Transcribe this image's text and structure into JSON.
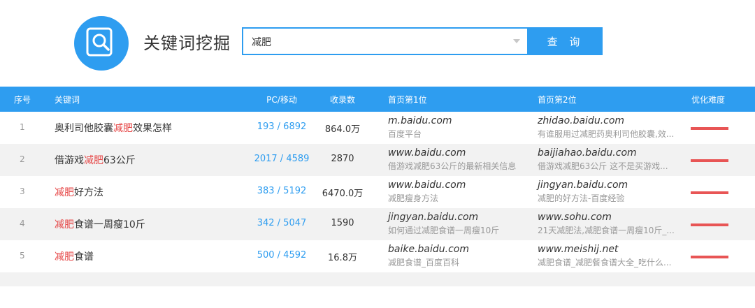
{
  "header": {
    "title": "关键词挖掘",
    "search_value": "减肥",
    "search_button": "查 询"
  },
  "table": {
    "headers": {
      "idx": "序号",
      "keyword": "关键词",
      "pc_mobile": "PC/移动",
      "indexed": "收录数",
      "page1_pos1": "首页第1位",
      "page1_pos2": "首页第2位",
      "difficulty": "优化难度"
    },
    "rows": [
      {
        "idx": "1",
        "kw_pre": "奥利司他胶囊",
        "kw_hl": "减肥",
        "kw_post": "效果怎样",
        "pc_mobile": "193 / 6892",
        "indexed": "864.0万",
        "p1_site": "m.baidu.com",
        "p1_desc": "百度平台",
        "p2_site": "zhidao.baidu.com",
        "p2_desc": "有谁服用过减肥药奥利司他胶囊,效...",
        "difficulty": "high"
      },
      {
        "idx": "2",
        "kw_pre": "借游戏",
        "kw_hl": "减肥",
        "kw_post": "63公斤",
        "pc_mobile": "2017 / 4589",
        "indexed": "2870",
        "p1_site": "www.baidu.com",
        "p1_desc": "借游戏减肥63公斤的最新相关信息",
        "p2_site": "baijiahao.baidu.com",
        "p2_desc": "借游戏减肥63公斤 这不是买游戏...",
        "difficulty": "high"
      },
      {
        "idx": "3",
        "kw_pre": "",
        "kw_hl": "减肥",
        "kw_post": "好方法",
        "pc_mobile": "383 / 5192",
        "indexed": "6470.0万",
        "p1_site": "www.baidu.com",
        "p1_desc": "减肥瘦身方法",
        "p2_site": "jingyan.baidu.com",
        "p2_desc": "减肥的好方法-百度经验",
        "difficulty": "high"
      },
      {
        "idx": "4",
        "kw_pre": "",
        "kw_hl": "减肥",
        "kw_post": "食谱一周瘦10斤",
        "pc_mobile": "342 / 5047",
        "indexed": "1590",
        "p1_site": "jingyan.baidu.com",
        "p1_desc": "如何通过减肥食谱一周瘦10斤",
        "p2_site": "www.sohu.com",
        "p2_desc": "21天减肥法,减肥食谱一周瘦10斤_...",
        "difficulty": "high"
      },
      {
        "idx": "5",
        "kw_pre": "",
        "kw_hl": "减肥",
        "kw_post": "食谱",
        "pc_mobile": "500 / 4592",
        "indexed": "16.8万",
        "p1_site": "baike.baidu.com",
        "p1_desc": "减肥食谱_百度百科",
        "p2_site": "www.meishij.net",
        "p2_desc": "减肥食谱_减肥餐食谱大全_吃什么...",
        "difficulty": "high"
      }
    ]
  },
  "colors": {
    "accent": "#2e9df0",
    "highlight": "#e64848",
    "difficulty_bar": "#e85555"
  },
  "icons": {
    "logo": "magnifier-safe-icon",
    "dropdown": "chevron-down-icon"
  }
}
